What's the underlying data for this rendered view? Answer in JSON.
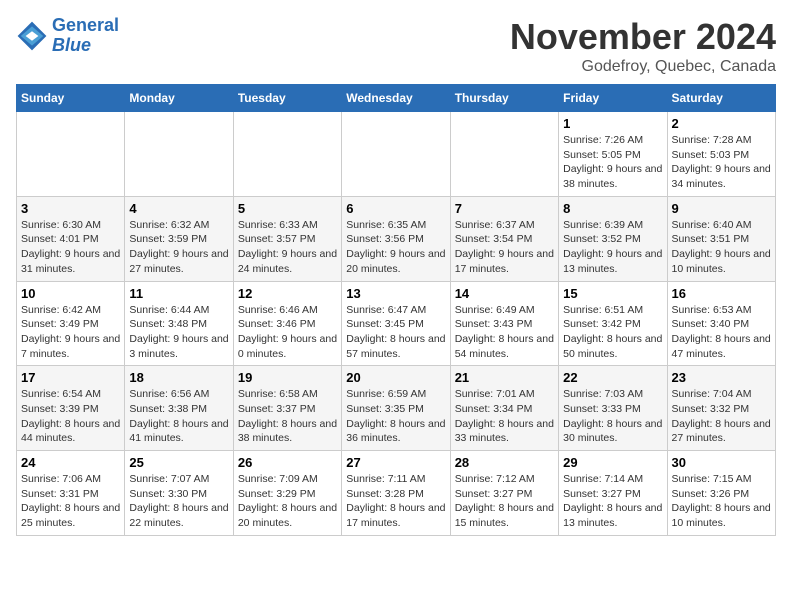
{
  "logo": {
    "line1": "General",
    "line2": "Blue"
  },
  "title": "November 2024",
  "location": "Godefroy, Quebec, Canada",
  "days_header": [
    "Sunday",
    "Monday",
    "Tuesday",
    "Wednesday",
    "Thursday",
    "Friday",
    "Saturday"
  ],
  "weeks": [
    [
      {
        "day": "",
        "info": ""
      },
      {
        "day": "",
        "info": ""
      },
      {
        "day": "",
        "info": ""
      },
      {
        "day": "",
        "info": ""
      },
      {
        "day": "",
        "info": ""
      },
      {
        "day": "1",
        "info": "Sunrise: 7:26 AM\nSunset: 5:05 PM\nDaylight: 9 hours and 38 minutes."
      },
      {
        "day": "2",
        "info": "Sunrise: 7:28 AM\nSunset: 5:03 PM\nDaylight: 9 hours and 34 minutes."
      }
    ],
    [
      {
        "day": "3",
        "info": "Sunrise: 6:30 AM\nSunset: 4:01 PM\nDaylight: 9 hours and 31 minutes."
      },
      {
        "day": "4",
        "info": "Sunrise: 6:32 AM\nSunset: 3:59 PM\nDaylight: 9 hours and 27 minutes."
      },
      {
        "day": "5",
        "info": "Sunrise: 6:33 AM\nSunset: 3:57 PM\nDaylight: 9 hours and 24 minutes."
      },
      {
        "day": "6",
        "info": "Sunrise: 6:35 AM\nSunset: 3:56 PM\nDaylight: 9 hours and 20 minutes."
      },
      {
        "day": "7",
        "info": "Sunrise: 6:37 AM\nSunset: 3:54 PM\nDaylight: 9 hours and 17 minutes."
      },
      {
        "day": "8",
        "info": "Sunrise: 6:39 AM\nSunset: 3:52 PM\nDaylight: 9 hours and 13 minutes."
      },
      {
        "day": "9",
        "info": "Sunrise: 6:40 AM\nSunset: 3:51 PM\nDaylight: 9 hours and 10 minutes."
      }
    ],
    [
      {
        "day": "10",
        "info": "Sunrise: 6:42 AM\nSunset: 3:49 PM\nDaylight: 9 hours and 7 minutes."
      },
      {
        "day": "11",
        "info": "Sunrise: 6:44 AM\nSunset: 3:48 PM\nDaylight: 9 hours and 3 minutes."
      },
      {
        "day": "12",
        "info": "Sunrise: 6:46 AM\nSunset: 3:46 PM\nDaylight: 9 hours and 0 minutes."
      },
      {
        "day": "13",
        "info": "Sunrise: 6:47 AM\nSunset: 3:45 PM\nDaylight: 8 hours and 57 minutes."
      },
      {
        "day": "14",
        "info": "Sunrise: 6:49 AM\nSunset: 3:43 PM\nDaylight: 8 hours and 54 minutes."
      },
      {
        "day": "15",
        "info": "Sunrise: 6:51 AM\nSunset: 3:42 PM\nDaylight: 8 hours and 50 minutes."
      },
      {
        "day": "16",
        "info": "Sunrise: 6:53 AM\nSunset: 3:40 PM\nDaylight: 8 hours and 47 minutes."
      }
    ],
    [
      {
        "day": "17",
        "info": "Sunrise: 6:54 AM\nSunset: 3:39 PM\nDaylight: 8 hours and 44 minutes."
      },
      {
        "day": "18",
        "info": "Sunrise: 6:56 AM\nSunset: 3:38 PM\nDaylight: 8 hours and 41 minutes."
      },
      {
        "day": "19",
        "info": "Sunrise: 6:58 AM\nSunset: 3:37 PM\nDaylight: 8 hours and 38 minutes."
      },
      {
        "day": "20",
        "info": "Sunrise: 6:59 AM\nSunset: 3:35 PM\nDaylight: 8 hours and 36 minutes."
      },
      {
        "day": "21",
        "info": "Sunrise: 7:01 AM\nSunset: 3:34 PM\nDaylight: 8 hours and 33 minutes."
      },
      {
        "day": "22",
        "info": "Sunrise: 7:03 AM\nSunset: 3:33 PM\nDaylight: 8 hours and 30 minutes."
      },
      {
        "day": "23",
        "info": "Sunrise: 7:04 AM\nSunset: 3:32 PM\nDaylight: 8 hours and 27 minutes."
      }
    ],
    [
      {
        "day": "24",
        "info": "Sunrise: 7:06 AM\nSunset: 3:31 PM\nDaylight: 8 hours and 25 minutes."
      },
      {
        "day": "25",
        "info": "Sunrise: 7:07 AM\nSunset: 3:30 PM\nDaylight: 8 hours and 22 minutes."
      },
      {
        "day": "26",
        "info": "Sunrise: 7:09 AM\nSunset: 3:29 PM\nDaylight: 8 hours and 20 minutes."
      },
      {
        "day": "27",
        "info": "Sunrise: 7:11 AM\nSunset: 3:28 PM\nDaylight: 8 hours and 17 minutes."
      },
      {
        "day": "28",
        "info": "Sunrise: 7:12 AM\nSunset: 3:27 PM\nDaylight: 8 hours and 15 minutes."
      },
      {
        "day": "29",
        "info": "Sunrise: 7:14 AM\nSunset: 3:27 PM\nDaylight: 8 hours and 13 minutes."
      },
      {
        "day": "30",
        "info": "Sunrise: 7:15 AM\nSunset: 3:26 PM\nDaylight: 8 hours and 10 minutes."
      }
    ]
  ]
}
